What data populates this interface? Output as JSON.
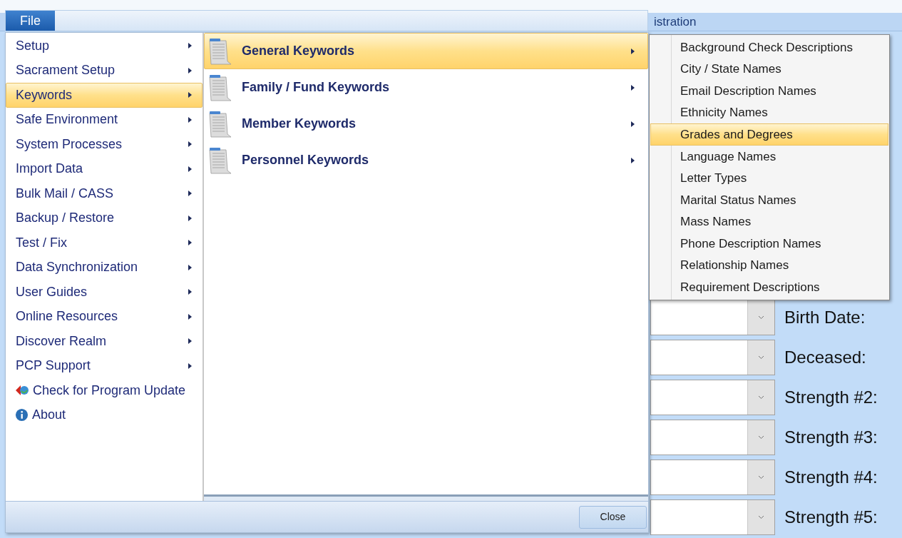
{
  "file_tab": {
    "label": "File"
  },
  "background_tab": {
    "label": "istration"
  },
  "form_rows": [
    {
      "label": "Birth Date:"
    },
    {
      "label": "Deceased:"
    },
    {
      "label": "Strength #2:"
    },
    {
      "label": "Strength #3:"
    },
    {
      "label": "Strength #4:"
    },
    {
      "label": "Strength #5:"
    }
  ],
  "menu": {
    "items": [
      {
        "label": "Setup",
        "kind": "submenu",
        "selected": false
      },
      {
        "label": "Sacrament Setup",
        "kind": "submenu",
        "selected": false
      },
      {
        "label": "Keywords",
        "kind": "submenu",
        "selected": true
      },
      {
        "label": "Safe Environment",
        "kind": "submenu",
        "selected": false
      },
      {
        "label": "System Processes",
        "kind": "submenu",
        "selected": false
      },
      {
        "label": "Import Data",
        "kind": "submenu",
        "selected": false
      },
      {
        "label": "Bulk Mail / CASS",
        "kind": "submenu",
        "selected": false
      },
      {
        "label": "Backup / Restore",
        "kind": "submenu",
        "selected": false
      },
      {
        "label": "Test / Fix",
        "kind": "submenu",
        "selected": false
      },
      {
        "label": "Data Synchronization",
        "kind": "submenu",
        "selected": false
      },
      {
        "label": "User Guides",
        "kind": "submenu",
        "selected": false
      },
      {
        "label": "Online Resources",
        "kind": "submenu",
        "selected": false
      },
      {
        "label": "Discover Realm",
        "kind": "submenu",
        "selected": false
      },
      {
        "label": "PCP Support",
        "kind": "submenu",
        "selected": false
      },
      {
        "label": "Check for Program Update",
        "kind": "command",
        "selected": false
      },
      {
        "label": "About",
        "kind": "command",
        "selected": false
      }
    ]
  },
  "submenu": {
    "items": [
      {
        "label": "General Keywords",
        "selected": true
      },
      {
        "label": "Family / Fund Keywords",
        "selected": false
      },
      {
        "label": "Member Keywords",
        "selected": false
      },
      {
        "label": "Personnel Keywords",
        "selected": false
      }
    ]
  },
  "flyout": {
    "items": [
      {
        "label": "Background Check Descriptions",
        "selected": false
      },
      {
        "label": "City / State Names",
        "selected": false
      },
      {
        "label": "Email Description Names",
        "selected": false
      },
      {
        "label": "Ethnicity Names",
        "selected": false
      },
      {
        "label": "Grades and Degrees",
        "selected": true
      },
      {
        "label": "Language Names",
        "selected": false
      },
      {
        "label": "Letter Types",
        "selected": false
      },
      {
        "label": "Marital Status Names",
        "selected": false
      },
      {
        "label": "Mass Names",
        "selected": false
      },
      {
        "label": "Phone Description Names",
        "selected": false
      },
      {
        "label": "Relationship Names",
        "selected": false
      },
      {
        "label": "Requirement Descriptions",
        "selected": false
      }
    ]
  },
  "footer": {
    "button": "Close"
  }
}
